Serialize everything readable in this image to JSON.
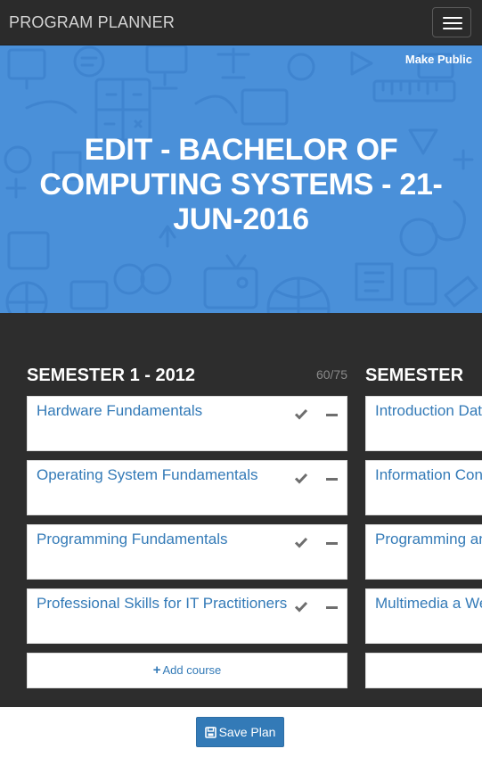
{
  "app": {
    "brand": "PROGRAM PLANNER",
    "menu_icon": "hamburger-icon"
  },
  "hero": {
    "make_public_label": "Make Public",
    "title": "EDIT - BACHELOR OF COMPUTING SYSTEMS - 21-JUN-2016"
  },
  "semesters": [
    {
      "title": "SEMESTER 1 - 2012",
      "credits": "60/75",
      "courses": [
        {
          "name": "Hardware Fundamentals"
        },
        {
          "name": "Operating System Fundamentals"
        },
        {
          "name": "Programming Fundamentals"
        },
        {
          "name": "Professional Skills for IT Practitioners"
        }
      ],
      "add_course_label": "Add course"
    },
    {
      "title": "SEMESTER",
      "courses": [
        {
          "name": "Introduction Database"
        },
        {
          "name": "Information Concepts"
        },
        {
          "name": "Programming and Practice"
        },
        {
          "name": "Multimedia a Website Dev"
        }
      ]
    }
  ],
  "footer": {
    "save_label": "Save Plan"
  },
  "colors": {
    "navbar": "#2b2b2b",
    "hero": "#4a90d9",
    "board": "#2d2d2d",
    "link": "#337ab7",
    "button": "#337ab7"
  }
}
